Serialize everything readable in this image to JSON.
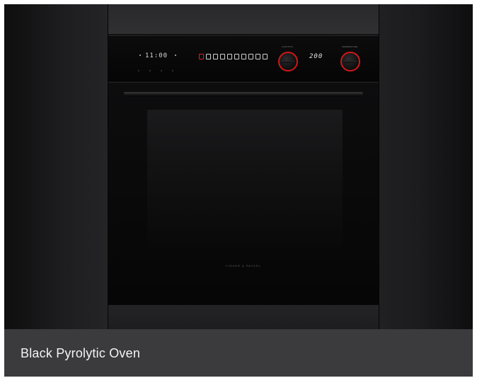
{
  "caption": "Black Pyrolytic Oven",
  "oven": {
    "clock_display": "11:00",
    "temperature_display": "200",
    "brand": "FISHER & PAYKEL",
    "function_icon_count": 10,
    "active_function_index": 0,
    "knob_labels": [
      "FUNCTION",
      "TEMPERATURE"
    ]
  },
  "colors": {
    "knob_ring": "#d01818",
    "active_icon": "#e02020",
    "caption_bg": "#3b3b3d",
    "caption_text": "#f4f4f4"
  }
}
